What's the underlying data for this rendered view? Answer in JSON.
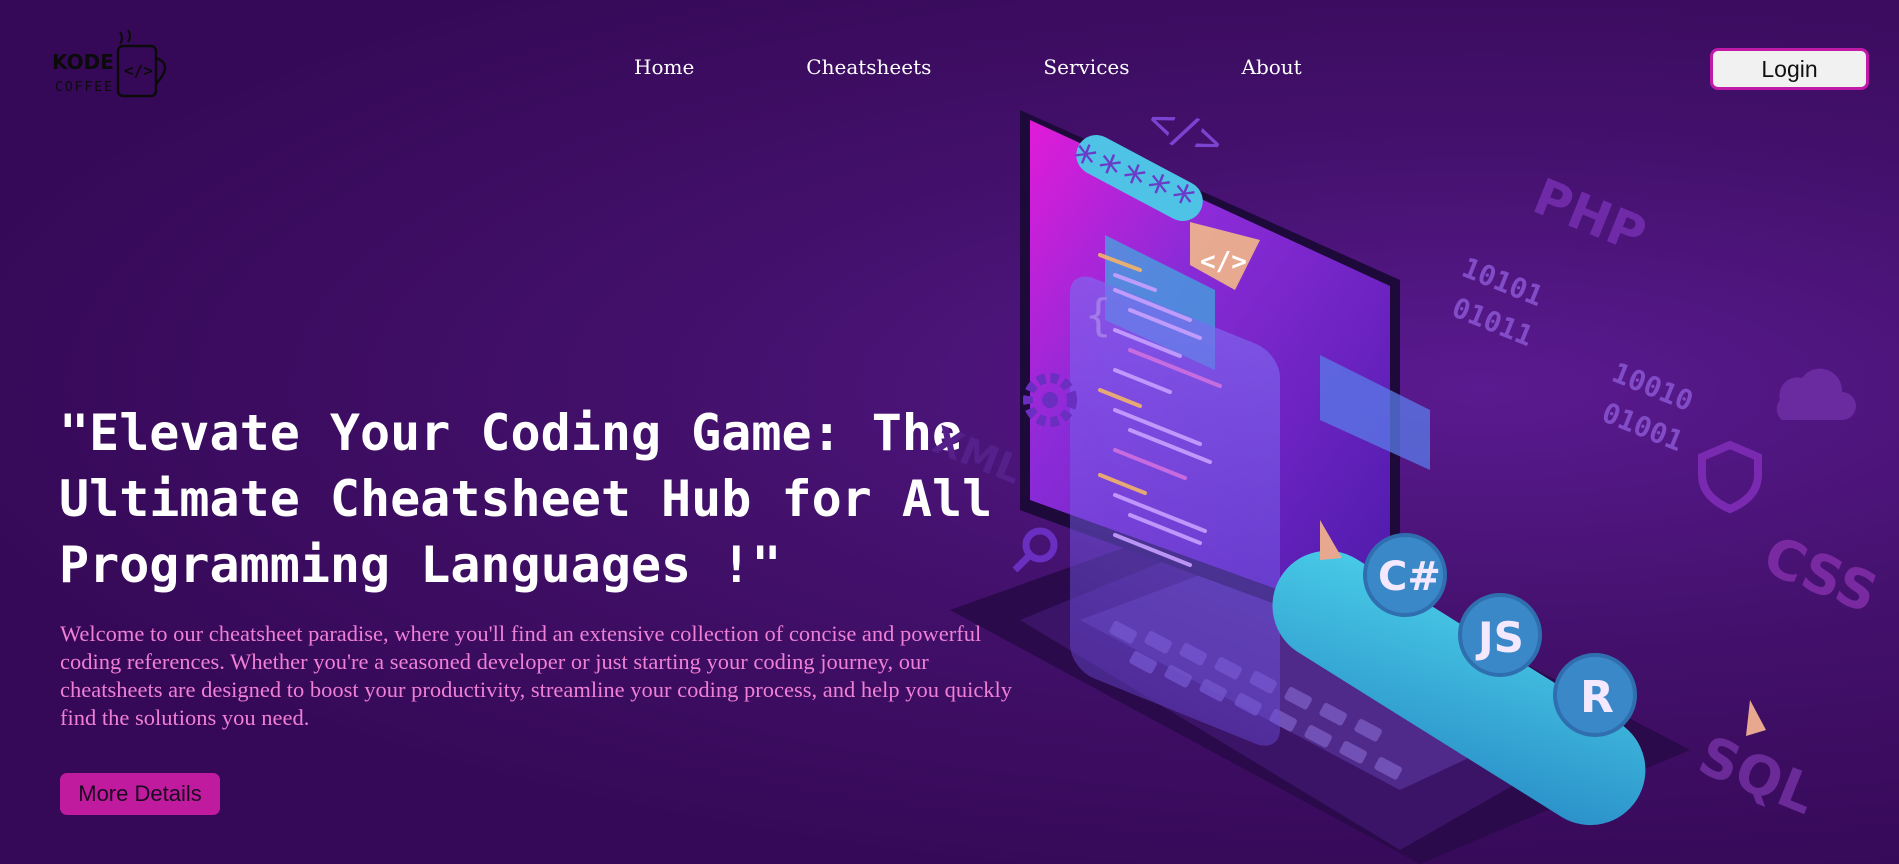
{
  "brand": {
    "logo_title": "KODE",
    "logo_subtitle": "COFFEE"
  },
  "nav": {
    "items": [
      "Home",
      "Cheatsheets",
      "Services",
      "About"
    ],
    "login_label": "Login"
  },
  "hero": {
    "title": "\"Elevate Your Coding Game: The Ultimate Cheatsheet Hub for All Programming Languages !\"",
    "description": "Welcome to our cheatsheet paradise, where you'll find an extensive collection of concise and powerful coding references. Whether you're a seasoned developer or just starting your coding journey, our cheatsheets are designed to boost your productivity, streamline your coding process, and help you quickly find the solutions you need.",
    "button_label": "More Details"
  },
  "illustration": {
    "code_tag": "</>",
    "code_tag2": "</>",
    "stars": "*****",
    "brace": "{",
    "languages": [
      "C#",
      "JS",
      "R"
    ],
    "side_labels": [
      "PHP",
      "CSS",
      "SQL",
      "XML"
    ],
    "binary": [
      "10101",
      "01011",
      "10010",
      "01001"
    ]
  },
  "colors": {
    "background": "#3a0b5c",
    "accent_pink": "#c01a9e",
    "description_text": "#f07fd6",
    "cyan": "#3fb6d8"
  }
}
